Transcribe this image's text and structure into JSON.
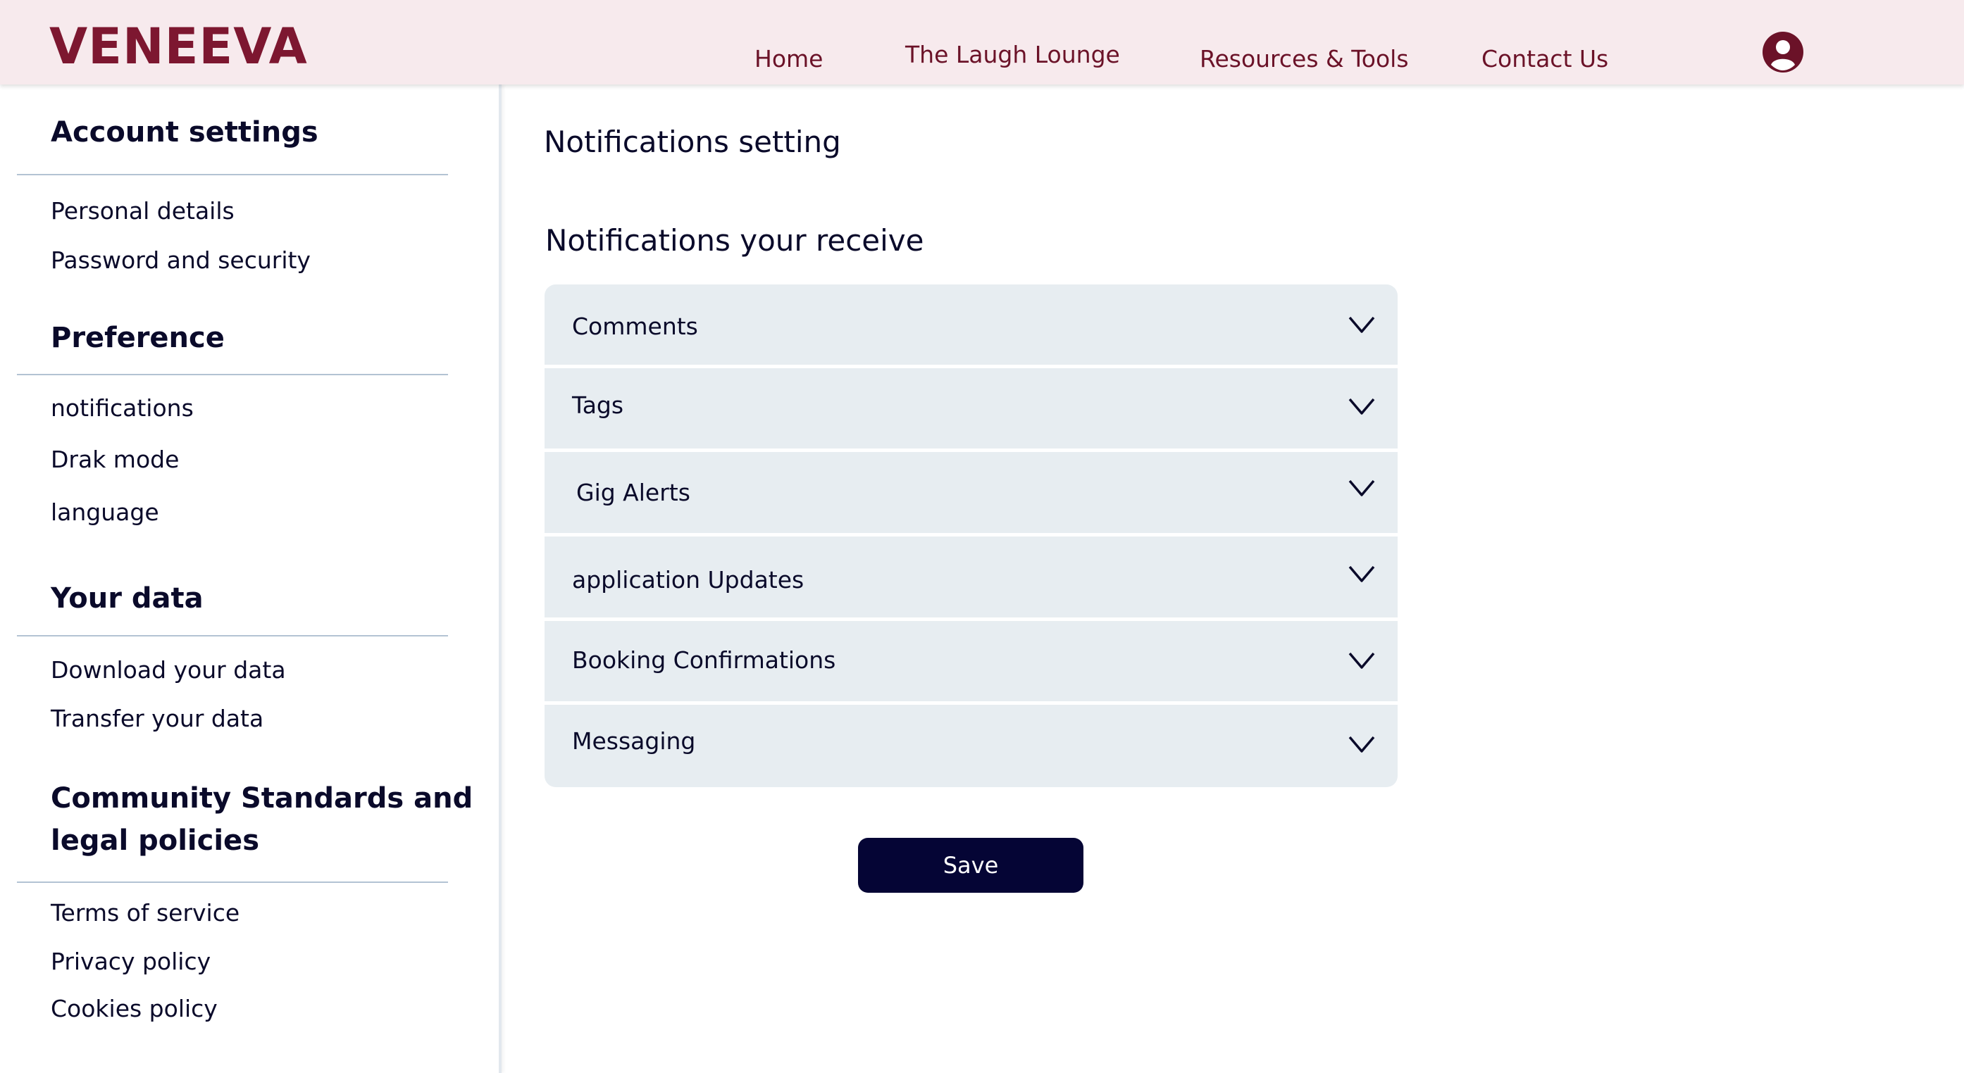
{
  "header": {
    "brand": "VENEEVA",
    "nav": {
      "home": "Home",
      "lounge": "The Laugh Lounge",
      "resources": "Resources & Tools",
      "contact": "Contact Us"
    },
    "avatar_icon": "user-circle-icon",
    "brand_color": "#7d1730",
    "background_color": "#f7eaed"
  },
  "sidebar": {
    "account": {
      "heading": "Account settings",
      "items": [
        "Personal details",
        "Password and security"
      ]
    },
    "preference": {
      "heading": "Preference",
      "items": [
        "notifications",
        "Drak mode",
        "language"
      ]
    },
    "your_data": {
      "heading": "Your data",
      "items": [
        "Download your data",
        "Transfer your data"
      ]
    },
    "community": {
      "heading_line1": "Community Standards and",
      "heading_line2": "legal policies",
      "items": [
        "Terms of service",
        "Privacy policy",
        "Cookies policy"
      ]
    }
  },
  "main": {
    "page_title": "Notifications setting",
    "section_title": "Notifications your receive",
    "accordion": [
      {
        "label": "Comments",
        "icon": "chevron-down-icon"
      },
      {
        "label": "Tags",
        "icon": "chevron-down-icon"
      },
      {
        "label": "Gig Alerts",
        "icon": "chevron-down-icon"
      },
      {
        "label": "application Updates",
        "icon": "chevron-down-icon"
      },
      {
        "label": "Booking Confirmations",
        "icon": "chevron-down-icon"
      },
      {
        "label": "Messaging",
        "icon": "chevron-down-icon"
      }
    ],
    "save_label": "Save",
    "accordion_background": "#e7edf1",
    "button_color": "#050535"
  }
}
